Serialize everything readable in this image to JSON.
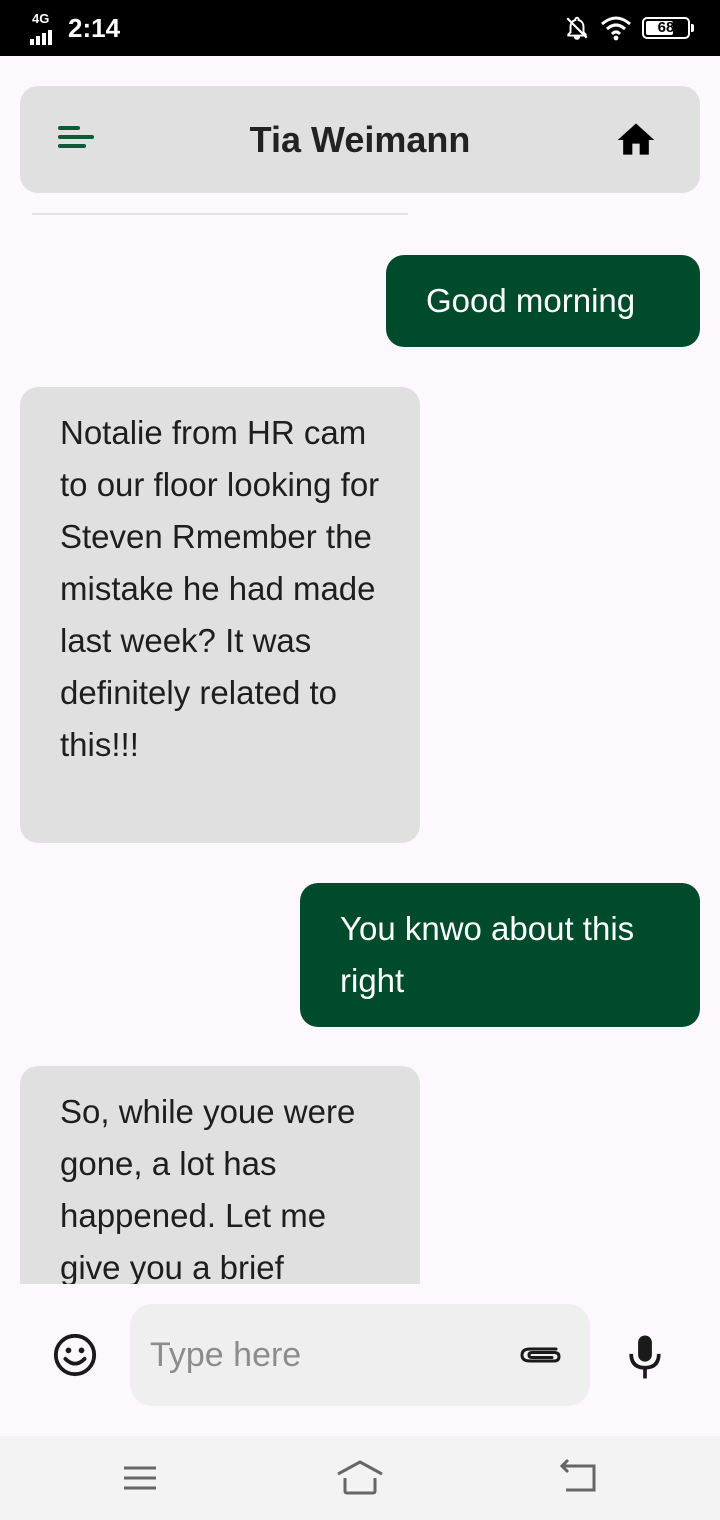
{
  "status_bar": {
    "network": "4G",
    "time": "2:14",
    "battery": "68",
    "battery_level": 0.68,
    "icons": [
      "signal-icon",
      "notifications-off-icon",
      "wifi-icon",
      "battery-icon"
    ]
  },
  "header": {
    "title": "Tia Weimann",
    "menu_icon": "menu-icon",
    "home_icon": "home-icon"
  },
  "messages": [
    {
      "direction": "out",
      "text": "Good morning"
    },
    {
      "direction": "in",
      "text": "Notalie from HR cam to our floor looking for Steven Rmember the mistake he had made last week? It was definitely related to this!!!"
    },
    {
      "direction": "out",
      "text": "You knwo about this right"
    },
    {
      "direction": "in",
      "text": "So, while youe were gone, a lot has happened. Let me give you a brief"
    }
  ],
  "composer": {
    "placeholder": "Type here",
    "value": "",
    "icons": [
      "emoji-icon",
      "attach-icon",
      "mic-icon"
    ]
  },
  "nav_bar": {
    "icons": [
      "recents-icon",
      "home-nav-icon",
      "back-icon"
    ]
  },
  "colors": {
    "outgoing_bubble": "#004b2b",
    "incoming_bubble": "#e0e0e0",
    "accent": "#0e5a36",
    "background": "#fdf8fd"
  }
}
